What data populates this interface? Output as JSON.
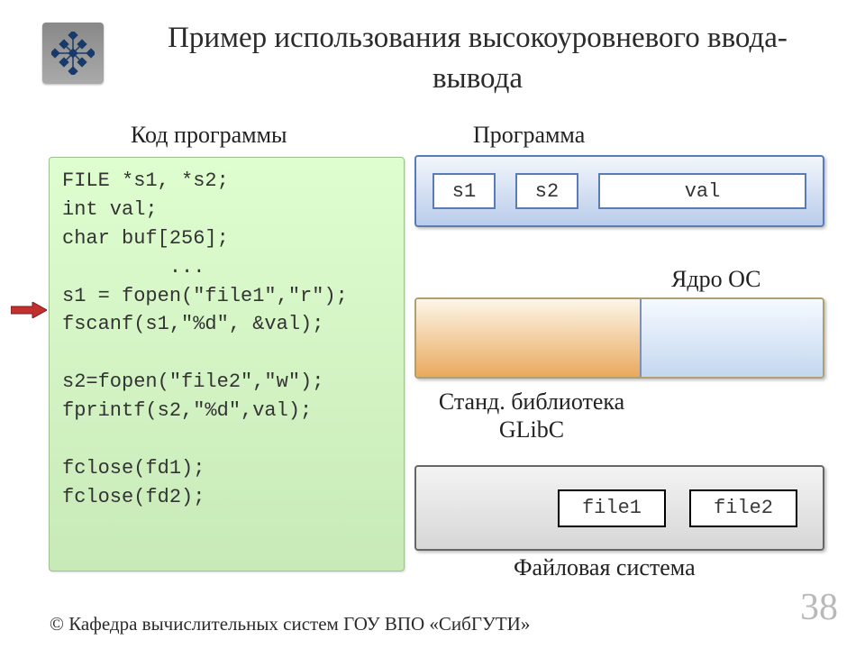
{
  "title": "Пример использования высокоуровневого ввода-вывода",
  "labels": {
    "code": "Код программы",
    "program": "Программа",
    "kernel": "Ядро ОС",
    "glibc": "Станд. библиотека GLibC",
    "fs": "Файловая система"
  },
  "code": "FILE *s1, *s2;\nint val;\nchar buf[256];\n         ...\ns1 = fopen(\"file1\",\"r\");\nfscanf(s1,\"%d\", &val);\n\ns2=fopen(\"file2\",\"w\");\nfprintf(s2,\"%d\",val);\n\nfclose(fd1);\nfclose(fd2);",
  "program_vars": {
    "s1": "s1",
    "s2": "s2",
    "val": "val"
  },
  "files": {
    "file1": "file1",
    "file2": "file2"
  },
  "footer": "© Кафедра вычислительных систем ГОУ ВПО «СибГУТИ»",
  "page_number": "38"
}
